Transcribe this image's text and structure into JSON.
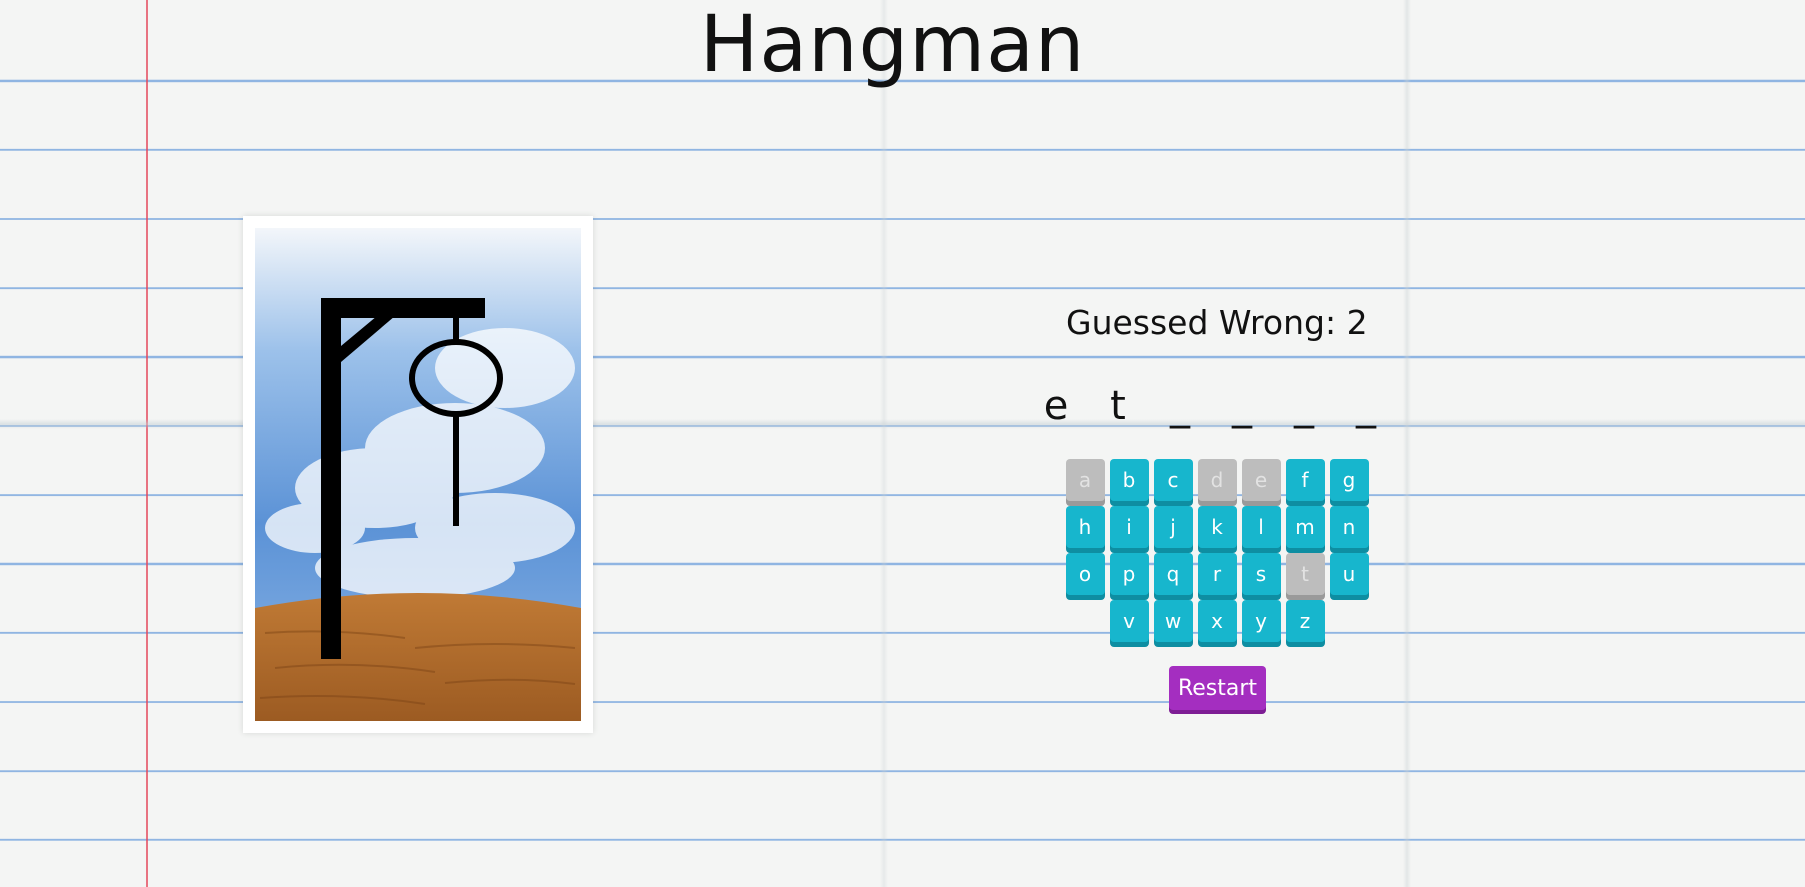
{
  "game": {
    "title": "Hangman",
    "wrong_label": "Guessed Wrong: 2",
    "wrong_count": 2,
    "word_slots": [
      "e",
      "t",
      "_",
      "_",
      "_",
      "_"
    ],
    "keyboard": {
      "rows": [
        [
          {
            "letter": "a",
            "used": true
          },
          {
            "letter": "b",
            "used": false
          },
          {
            "letter": "c",
            "used": false
          },
          {
            "letter": "d",
            "used": true
          },
          {
            "letter": "e",
            "used": true
          },
          {
            "letter": "f",
            "used": false
          },
          {
            "letter": "g",
            "used": false
          }
        ],
        [
          {
            "letter": "h",
            "used": false
          },
          {
            "letter": "i",
            "used": false
          },
          {
            "letter": "j",
            "used": false
          },
          {
            "letter": "k",
            "used": false
          },
          {
            "letter": "l",
            "used": false
          },
          {
            "letter": "m",
            "used": false
          },
          {
            "letter": "n",
            "used": false
          }
        ],
        [
          {
            "letter": "o",
            "used": false
          },
          {
            "letter": "p",
            "used": false
          },
          {
            "letter": "q",
            "used": false
          },
          {
            "letter": "r",
            "used": false
          },
          {
            "letter": "s",
            "used": false
          },
          {
            "letter": "t",
            "used": true
          },
          {
            "letter": "u",
            "used": false
          }
        ],
        [
          {
            "letter": "v",
            "used": false
          },
          {
            "letter": "w",
            "used": false
          },
          {
            "letter": "x",
            "used": false
          },
          {
            "letter": "y",
            "used": false
          },
          {
            "letter": "z",
            "used": false
          }
        ]
      ]
    },
    "restart_label": "Restart"
  },
  "colors": {
    "key_active": "#17b6cd",
    "key_used": "#bdbdbd",
    "restart": "#a42ec0"
  }
}
